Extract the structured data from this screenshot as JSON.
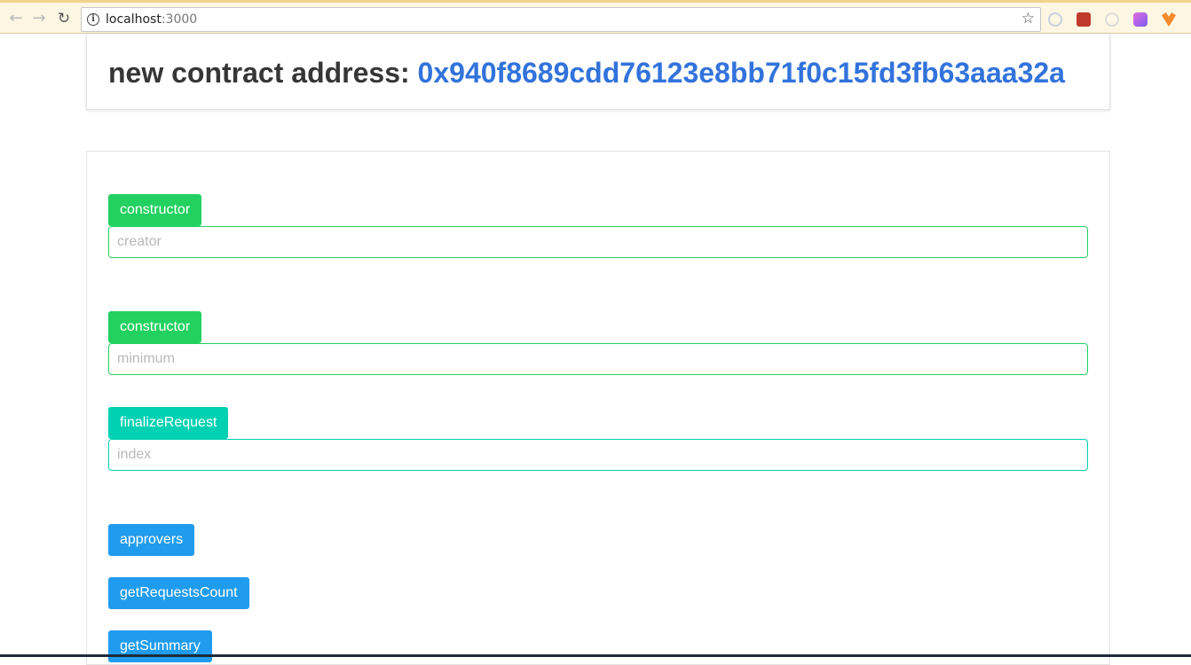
{
  "browser": {
    "url_host": "localhost",
    "url_port": ":3000"
  },
  "header": {
    "label": "new contract address:",
    "address": "0x940f8689cdd76123e8bb71f0c15fd3fb63aaa32a"
  },
  "functions": [
    {
      "label": "constructor",
      "placeholder": "creator"
    },
    {
      "label": "constructor",
      "placeholder": "minimum"
    },
    {
      "label": "finalizeRequest",
      "placeholder": "index"
    }
  ],
  "calls": [
    {
      "label": "approvers"
    },
    {
      "label": "getRequestsCount"
    },
    {
      "label": "getSummary"
    }
  ],
  "colors": {
    "constructor": "#23d160",
    "finalize": "#00d1b2",
    "call": "#209cee",
    "address": "#3273dc"
  }
}
